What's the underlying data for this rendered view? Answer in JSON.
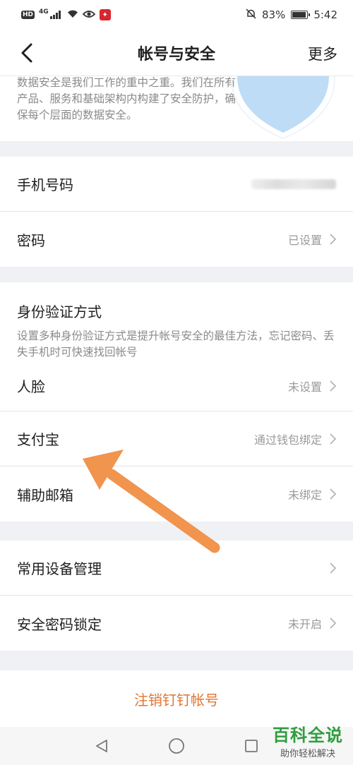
{
  "status_bar": {
    "hd": "HD",
    "network": "4G",
    "battery": "83%",
    "battery_level": 0.83,
    "time": "5:42"
  },
  "header": {
    "title": "帐号与安全",
    "more": "更多"
  },
  "intro": {
    "text": "数据安全是我们工作的重中之重。我们在所有产品、服务和基础架构内构建了安全防护，确保每个层面的数据安全。"
  },
  "account": {
    "phone_label": "手机号码",
    "password_label": "密码",
    "password_value": "已设置"
  },
  "verification": {
    "title": "身份验证方式",
    "description": "设置多种身份验证方式是提升帐号安全的最佳方法，忘记密码、丢失手机时可快速找回帐号",
    "items": [
      {
        "label": "人脸",
        "value": "未设置"
      },
      {
        "label": "支付宝",
        "value": "通过钱包绑定"
      },
      {
        "label": "辅助邮箱",
        "value": "未绑定"
      }
    ]
  },
  "devices": {
    "items": [
      {
        "label": "常用设备管理",
        "value": ""
      },
      {
        "label": "安全密码锁定",
        "value": "未开启"
      }
    ]
  },
  "logout_label": "注销钉钉帐号",
  "watermark": {
    "main": "百科全说",
    "sub": "助你轻松解决"
  },
  "colors": {
    "accent": "#e0762f",
    "arrow": "#f0944e",
    "watermark": "#2e9e3e",
    "shield": "#a8d0f2"
  }
}
